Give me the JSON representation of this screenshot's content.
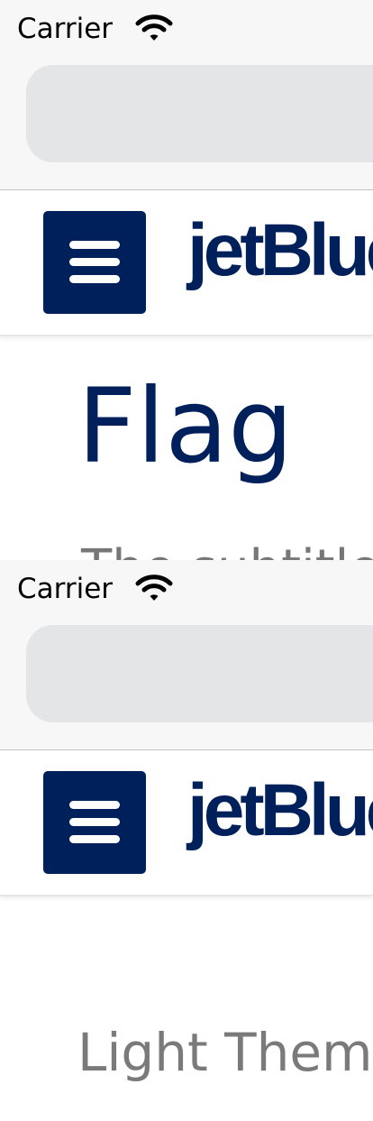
{
  "status_bar": {
    "carrier": "Carrier",
    "wifi_icon": "wifi-icon"
  },
  "browser": {
    "lock_icon": "lock-icon",
    "lock_colors": [
      "#ff0000",
      "#000000"
    ]
  },
  "header": {
    "menu_icon": "hamburger-menu-icon",
    "logo_text": "jetBlue",
    "brand_color": "#00205b"
  },
  "screens": [
    {
      "heading": "Flag",
      "peek_text": "The subtitle"
    },
    {
      "section_heading": "Light Theme"
    }
  ]
}
